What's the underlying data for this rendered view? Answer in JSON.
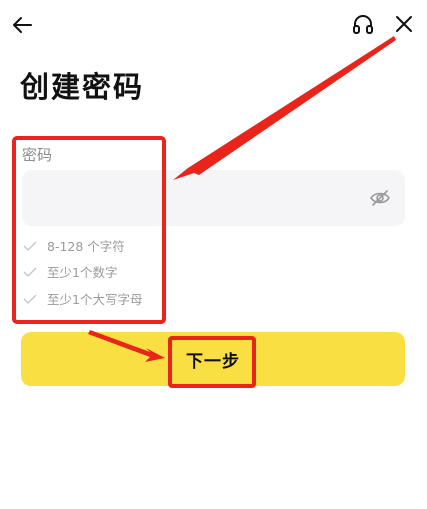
{
  "header": {
    "back_icon": "arrow-left-icon",
    "support_icon": "headset-icon",
    "close_icon": "close-x-icon"
  },
  "page": {
    "title": "创建密码"
  },
  "password": {
    "label": "密码",
    "value": "",
    "visibility_icon": "eye-off-icon"
  },
  "requirements": [
    {
      "text": "8-128 个字符"
    },
    {
      "text": "至少1个数字"
    },
    {
      "text": "至少1个大写字母"
    }
  ],
  "next_button": {
    "label": "下一步"
  },
  "colors": {
    "accent": "#f9df42",
    "annotation": "#e8241b",
    "field_bg": "#f5f4f7"
  }
}
